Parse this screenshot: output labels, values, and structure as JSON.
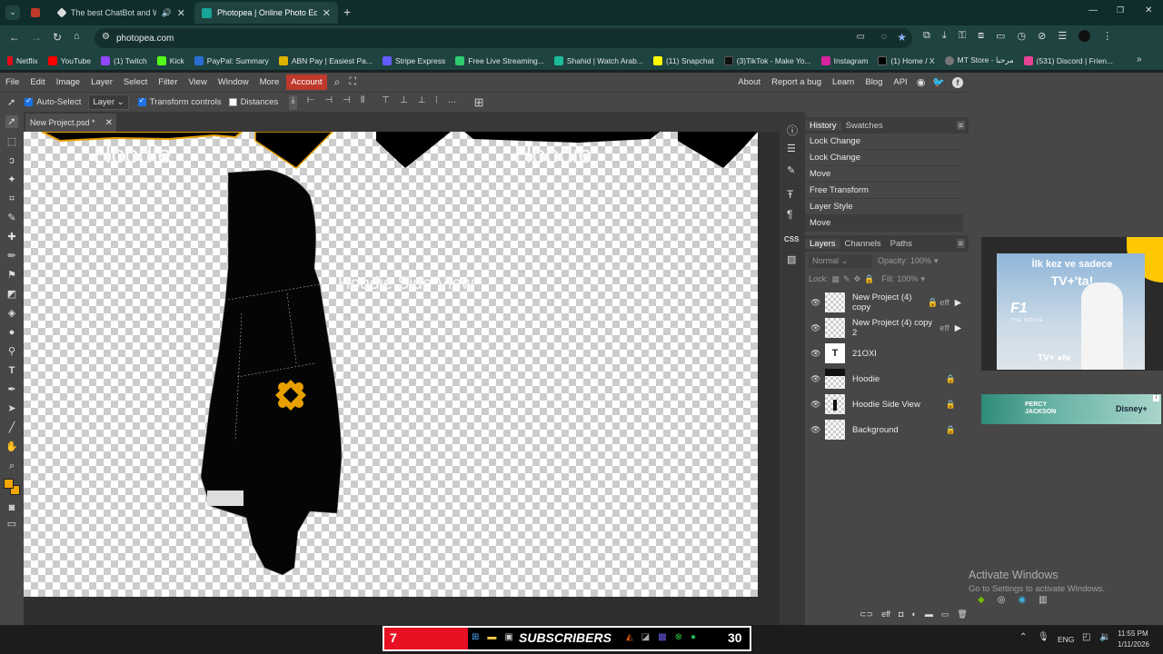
{
  "browser": {
    "tabs": [
      {
        "label": "The best ChatBot and Widg",
        "active": false
      },
      {
        "label": "Photopea | Online Photo Editor",
        "active": true
      }
    ],
    "url": "photopea.com",
    "bookmarks": [
      "Netflix",
      "YouTube",
      "(1) Twitch",
      "Kick",
      "PayPal: Summary",
      "ABN Pay | Easiest Pa...",
      "Stripe Express",
      "Free Live Streaming...",
      "Shahid | Watch Arab...",
      "(11) Snapchat",
      "(3)TikTok - Make Yo...",
      "Instagram",
      "(1) Home / X",
      "MT Store - مرحبا",
      "(531) Discord | Frien..."
    ]
  },
  "photopea": {
    "menu": [
      "File",
      "Edit",
      "Image",
      "Layer",
      "Select",
      "Filter",
      "View",
      "Window",
      "More"
    ],
    "account": "Account",
    "right_menu": [
      "About",
      "Report a bug",
      "Learn",
      "Blog",
      "API"
    ],
    "options": {
      "auto_select": "Auto-Select",
      "layer_select": "Layer",
      "transform_controls": "Transform controls",
      "distances": "Distances"
    },
    "doc_tab": "New Project.psd *",
    "canvas_text": {
      "hoodie_left": "Hoodie",
      "hoodie_right": "Hoodie",
      "side_view": "Hoodie Side View"
    },
    "history_tabs": [
      "History",
      "Swatches"
    ],
    "history": [
      "Lock Change",
      "Lock Change",
      "Move",
      "Free Transform",
      "Layer Style",
      "Move"
    ],
    "layer_tabs": [
      "Layers",
      "Channels",
      "Paths"
    ],
    "blend_mode": "Normal",
    "opacity_label": "Opacity:",
    "opacity": "100%",
    "lock_label": "Lock:",
    "fill_label": "Fill:",
    "fill": "100%",
    "layers": [
      {
        "name": "New Project (4) copy",
        "locked": true,
        "eff": "eff"
      },
      {
        "name": "New Project (4) copy 2",
        "locked": false,
        "eff": "eff"
      },
      {
        "name": "21OXI",
        "type": "text"
      },
      {
        "name": "Hoodie",
        "locked": true
      },
      {
        "name": "Hoodie Side View",
        "locked": true
      },
      {
        "name": "Background",
        "locked": true
      }
    ]
  },
  "ads": {
    "ad1_line1": "İlk kez ve sadece",
    "ad1_line2": "TV+'ta!",
    "ad1_brand": "F1",
    "ad1_movie": "THE MOVIE",
    "ad2_title": "PERCY JACKSON",
    "ad2_brand": "Disney+"
  },
  "watermark": {
    "title": "Activate Windows",
    "sub": "Go to Settings to activate Windows."
  },
  "taskbar": {
    "left_num": "7",
    "subscribers": "SUBSCRIBERS",
    "right_num": "30",
    "lang": "ENG",
    "time": "11:55 PM",
    "date": "1/11/2026"
  }
}
